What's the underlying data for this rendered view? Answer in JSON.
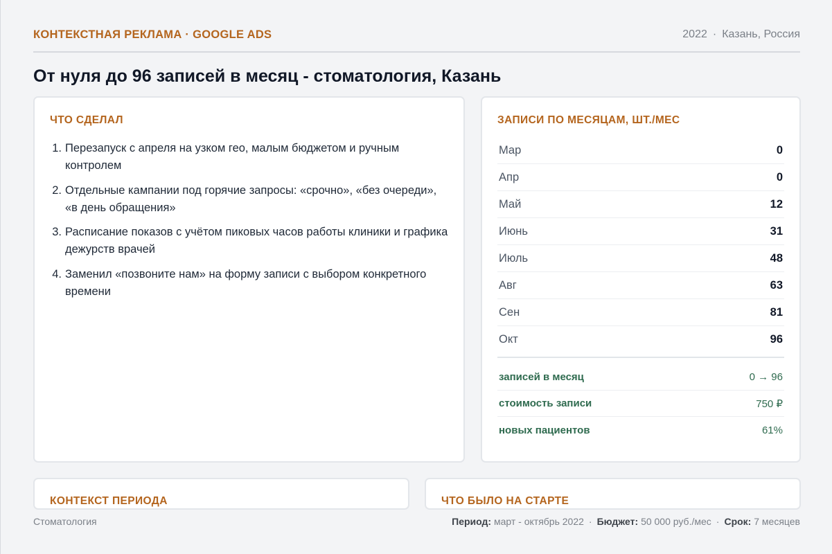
{
  "header": {
    "eyebrow": "КОНТЕКСТНАЯ РЕКЛАМА · GOOGLE ADS",
    "year": "2022",
    "location": "Казань, Россия"
  },
  "title": "От нуля до 96 записей в месяц - стоматология, Казань",
  "left_card": {
    "title": "ЧТО СДЕЛАЛ",
    "steps": [
      {
        "num": "1.",
        "text": "Перезапуск с апреля на узком гео, малым бюджетом и ручным контролем"
      },
      {
        "num": "2.",
        "text": "Отдельные кампании под горячие запросы: «срочно», «без очереди», «в день обращения»"
      },
      {
        "num": "3.",
        "text": "Расписание показов с учётом пиковых часов работы клиники и графика дежурств врачей"
      },
      {
        "num": "4.",
        "text": "Заменил «позвоните нам» на форму записи с выбором конкретного времени"
      }
    ]
  },
  "right_card": {
    "title": "ЗАПИСИ ПО МЕСЯЦАМ, ШТ./МЕС",
    "months": [
      {
        "name": "Мар",
        "value": "0"
      },
      {
        "name": "Апр",
        "value": "0"
      },
      {
        "name": "Май",
        "value": "12"
      },
      {
        "name": "Июнь",
        "value": "31"
      },
      {
        "name": "Июль",
        "value": "48"
      },
      {
        "name": "Авг",
        "value": "63"
      },
      {
        "name": "Сен",
        "value": "81"
      },
      {
        "name": "Окт",
        "value": "96"
      }
    ],
    "stats": [
      {
        "label": "записей в месяц",
        "value": "0 → 96"
      },
      {
        "label": "стоимость записи",
        "value": "750 ₽"
      },
      {
        "label": "новых пациентов",
        "value": "61%"
      }
    ]
  },
  "bottom_cards": {
    "context_title": "КОНТЕКСТ ПЕРИОДА",
    "start_title": "ЧТО БЫЛО НА СТАРТЕ"
  },
  "footer": {
    "category": "Стоматология",
    "period_label": "Период:",
    "period_value": "март - октябрь 2022",
    "budget_label": "Бюджет:",
    "budget_value": "50 000 руб./мес",
    "term_label": "Срок:",
    "term_value": "7 месяцев"
  },
  "colors": {
    "accent": "#b4651e",
    "stat_green": "#2f6b4f",
    "background": "#f3f4f6"
  }
}
